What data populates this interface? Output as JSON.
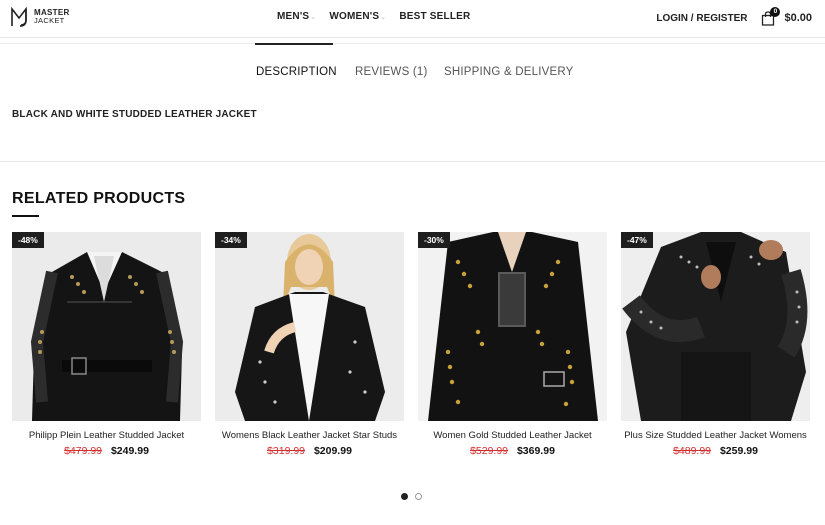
{
  "brand": {
    "line1": "MASTER",
    "line2": "JACKET"
  },
  "nav": {
    "items": [
      {
        "label": "MEN'S",
        "has_dropdown": true
      },
      {
        "label": "WOMEN'S",
        "has_dropdown": true
      },
      {
        "label": "BEST SELLER",
        "has_dropdown": false
      }
    ]
  },
  "header": {
    "login_label": "LOGIN / REGISTER",
    "cart_count": "0",
    "cart_total": "$0.00",
    "cart_icon": "shopping-bag-icon"
  },
  "tabs": [
    {
      "label": "DESCRIPTION",
      "active": true
    },
    {
      "label": "REVIEWS (1)",
      "active": false
    },
    {
      "label": "SHIPPING & DELIVERY",
      "active": false
    }
  ],
  "description": {
    "title": "BLACK AND WHITE STUDDED LEATHER JACKET"
  },
  "related": {
    "title": "RELATED PRODUCTS",
    "products": [
      {
        "badge": "-48%",
        "name": "Philipp Plein Leather Studded Jacket",
        "old_price": "$479.99",
        "price": "$249.99"
      },
      {
        "badge": "-34%",
        "name": "Womens Black Leather Jacket Star Studs",
        "old_price": "$319.99",
        "price": "$209.99"
      },
      {
        "badge": "-30%",
        "name": "Women Gold Studded Leather Jacket",
        "old_price": "$529.99",
        "price": "$369.99"
      },
      {
        "badge": "-47%",
        "name": "Plus Size Studded Leather Jacket Womens",
        "old_price": "$489.99",
        "price": "$259.99"
      }
    ]
  },
  "pagination": {
    "pages": 2,
    "active": 1
  },
  "colors": {
    "sale_red": "#d43030",
    "badge_bg": "#1e1e1e",
    "text_dark": "#111111"
  }
}
